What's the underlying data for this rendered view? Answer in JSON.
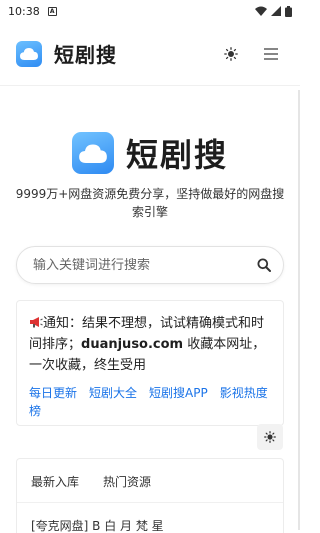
{
  "status": {
    "time": "10:38",
    "notification_icon": "a-box-icon",
    "wifi_icon": "wifi-icon",
    "signal_icon": "signal-icon",
    "battery_icon": "battery-icon"
  },
  "header": {
    "brand": "短剧搜",
    "theme_icon": "sun-icon",
    "menu_icon": "menu-icon"
  },
  "hero": {
    "title": "短剧搜",
    "tagline": "9999万+网盘资源免费分享，坚持做最好的网盘搜索引擎"
  },
  "search": {
    "placeholder": "输入关键词进行搜索",
    "value": "",
    "icon": "search-icon"
  },
  "notice": {
    "icon": "megaphone-icon",
    "text_pre": "通知：结果不理想，试试精确模式和时间排序；",
    "domain": "duanjuso.com",
    "text_post": " 收藏本网址，一次收藏，终生受用",
    "links": [
      "每日更新",
      "短剧大全",
      "短剧搜APP",
      "影视热度榜"
    ]
  },
  "float_theme_icon": "sun-icon",
  "tabs": {
    "items": [
      "最新入库",
      "热门资源"
    ]
  },
  "list": {
    "first_item": "[夸克网盘] B 白 月 梵 星"
  },
  "colors": {
    "accent": "#1a73e8",
    "logo_blue": "#2f8cf3"
  }
}
